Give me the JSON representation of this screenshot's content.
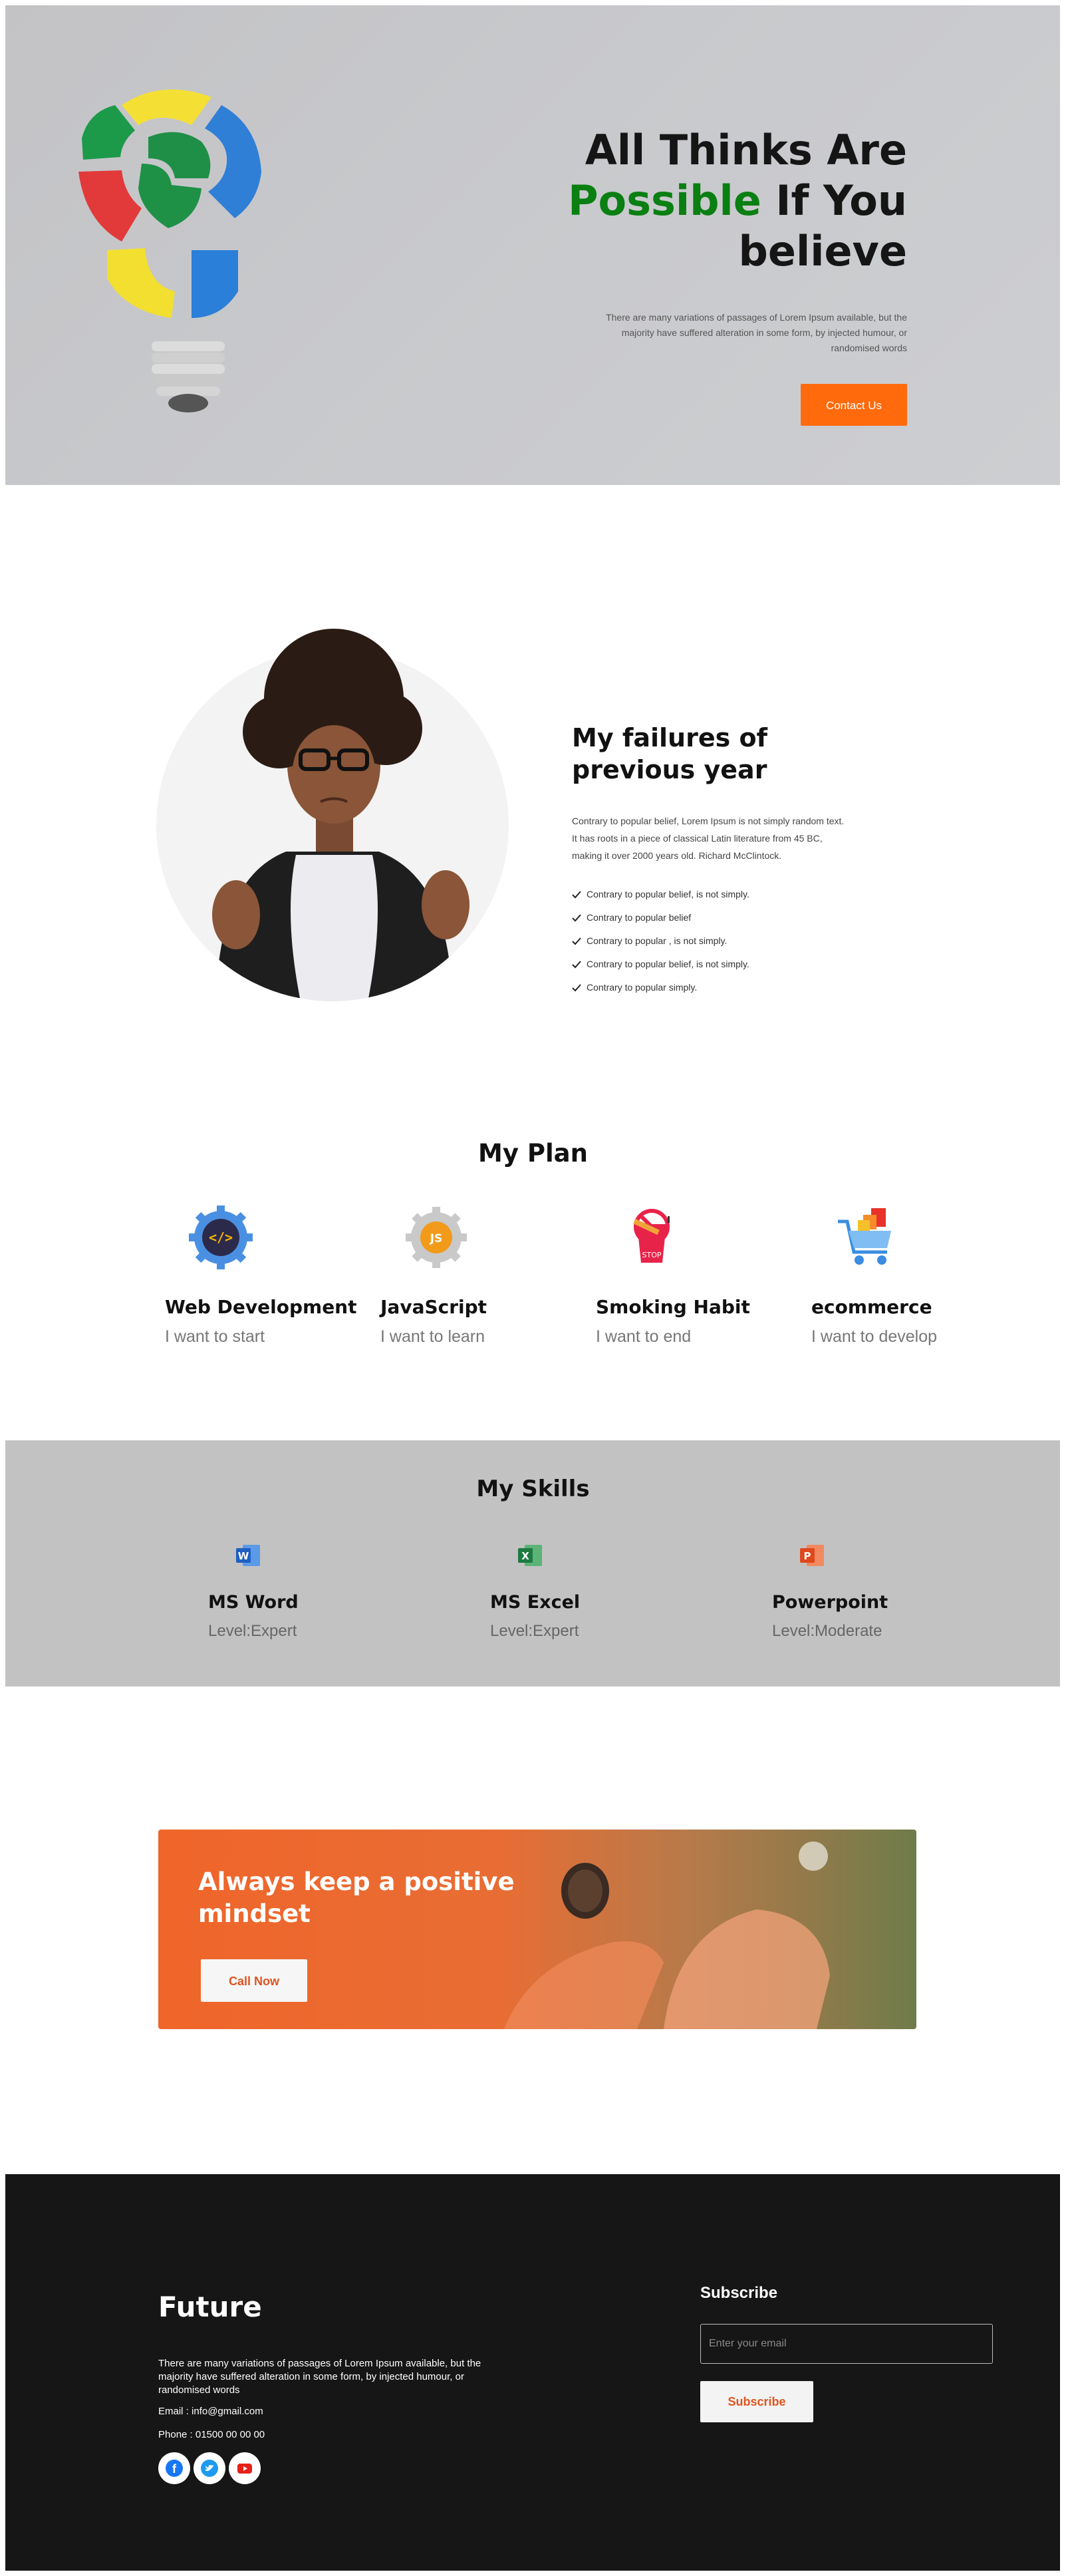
{
  "hero": {
    "title_line1": "All Thinks Are",
    "title_green": "Possible",
    "title_rest": " If You",
    "title_line3": "believe",
    "description": "There are many variations of passages of Lorem Ipsum available, but the majority have suffered alteration in some form, by injected humour, or randomised words",
    "cta_label": "Contact Us",
    "accent_color": "#ff6a0d",
    "highlight_color": "#0a7f12"
  },
  "failures": {
    "title": "My failures of previous year",
    "description": "Contrary to popular belief, Lorem Ipsum is not simply random text. It has roots in a piece of classical Latin literature from 45 BC, making it over 2000 years old. Richard McClintock.",
    "items": [
      "Contrary to popular belief, is not simply.",
      "Contrary to popular belief",
      "Contrary to popular , is not simply.",
      "Contrary to popular belief, is not simply.",
      "Contrary to popular simply."
    ]
  },
  "plan": {
    "title": "My Plan",
    "items": [
      {
        "name": "Web Development",
        "sub": "I want to start",
        "icon": "code-gear-icon"
      },
      {
        "name": "JavaScript",
        "sub": "I want to learn",
        "icon": "js-gear-icon"
      },
      {
        "name": "Smoking Habit",
        "sub": "I want to end",
        "icon": "no-smoking-icon"
      },
      {
        "name": "ecommerce",
        "sub": "I want to develop",
        "icon": "shopping-cart-icon"
      }
    ]
  },
  "skills": {
    "title": "My Skills",
    "items": [
      {
        "name": "MS Word",
        "level": "Level:Expert",
        "icon": "word-icon"
      },
      {
        "name": "MS Excel",
        "level": "Level:Expert",
        "icon": "excel-icon"
      },
      {
        "name": "Powerpoint",
        "level": "Level:Moderate",
        "icon": "powerpoint-icon"
      }
    ]
  },
  "banner": {
    "title": "Always keep a positive mindset",
    "cta_label": "Call Now"
  },
  "footer": {
    "brand": "Future",
    "description": "There are many variations of passages of Lorem Ipsum available, but the majority have suffered alteration in some form, by injected humour, or randomised words",
    "email": "Email : info@gmail.com",
    "phone": "Phone : 01500 00 00 00",
    "socials": [
      "facebook-icon",
      "twitter-icon",
      "youtube-icon"
    ],
    "subscribe_title": "Subscribe",
    "email_placeholder": "Enter your email",
    "subscribe_label": "Subscribe"
  }
}
